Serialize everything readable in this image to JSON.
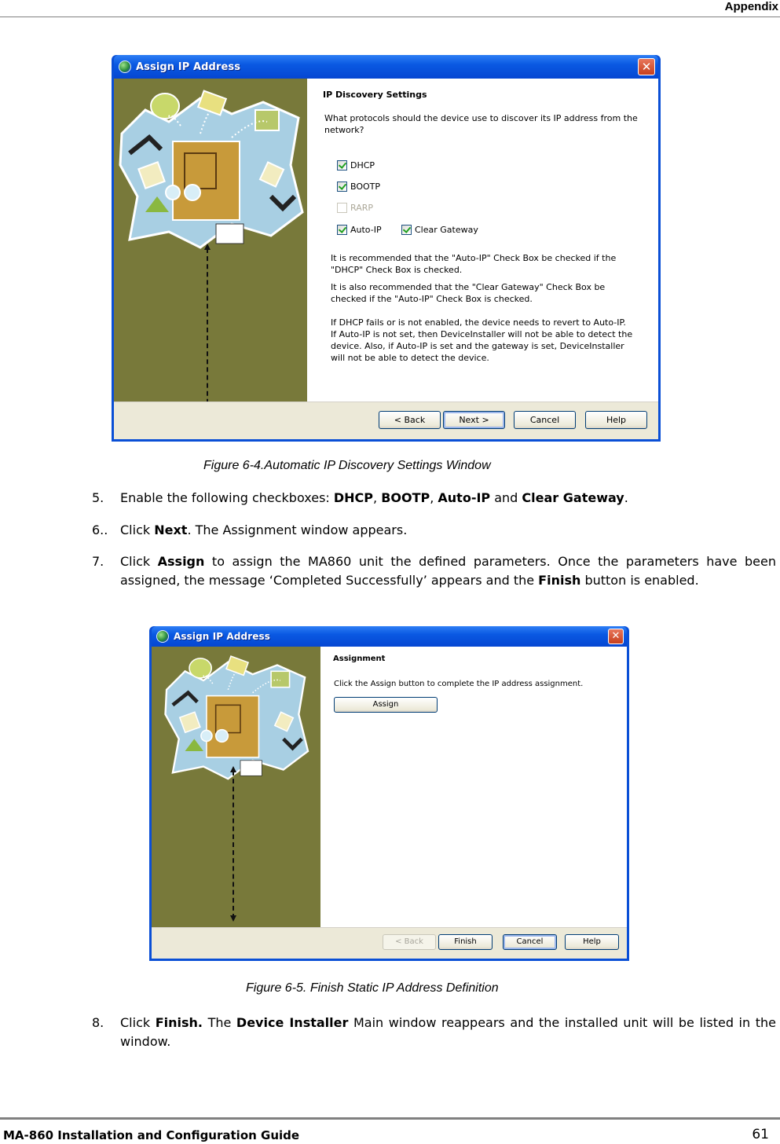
{
  "page": {
    "header_title": "Appendix",
    "footer_guide": "MA-860 Installation and Configuration Guide",
    "page_number": "61"
  },
  "figure1": {
    "window_title": "Assign IP Address",
    "close_glyph": "✕",
    "section_title": "IP Discovery Settings",
    "question": "What protocols should the device use to discover its IP address from the network?",
    "checkboxes": [
      {
        "label": "DHCP",
        "checked": true,
        "enabled": true
      },
      {
        "label": "BOOTP",
        "checked": true,
        "enabled": true
      },
      {
        "label": "RARP",
        "checked": false,
        "enabled": false
      },
      {
        "label": "Auto-IP",
        "checked": true,
        "enabled": true
      },
      {
        "label": "Clear Gateway",
        "checked": true,
        "enabled": true
      }
    ],
    "note1": "It is recommended that the \"Auto-IP\" Check Box be checked if the \"DHCP\" Check Box is checked.",
    "note2": "It is  also recommended that the \"Clear Gateway\" Check Box be checked if the \"Auto-IP\" Check Box is checked.",
    "note3": "If DHCP fails or is not enabled, the device needs to revert to Auto-IP.  If Auto-IP is not set, then DeviceInstaller will not be able to detect the device.  Also, if Auto-IP is set and the gateway is set, DeviceInstaller will not be able to detect the device.",
    "buttons": {
      "back": "< Back",
      "next": "Next >",
      "cancel": "Cancel",
      "help": "Help"
    },
    "caption": "Figure 6-4.Automatic  IP Discovery Settings Window"
  },
  "steps_a": [
    {
      "num": "5.",
      "parts": [
        {
          "t": "Enable the following checkboxes: ",
          "b": false
        },
        {
          "t": "DHCP",
          "b": true
        },
        {
          "t": ", ",
          "b": false
        },
        {
          "t": "BOOTP",
          "b": true
        },
        {
          "t": ", ",
          "b": false
        },
        {
          "t": "Auto-IP",
          "b": true
        },
        {
          "t": " and ",
          "b": false
        },
        {
          "t": "Clear Gateway",
          "b": true
        },
        {
          "t": ".",
          "b": false
        }
      ]
    },
    {
      "num": "6..",
      "parts": [
        {
          "t": "Click ",
          "b": false
        },
        {
          "t": "Next",
          "b": true
        },
        {
          "t": ". The Assignment window appears.",
          "b": false
        }
      ]
    },
    {
      "num": "7.",
      "parts": [
        {
          "t": "Click ",
          "b": false
        },
        {
          "t": "Assign",
          "b": true
        },
        {
          "t": " to assign the MA860 unit the defined parameters. Once the parameters have been assigned, the message ‘Completed Successfully’ appears and the ",
          "b": false
        },
        {
          "t": "Finish",
          "b": true
        },
        {
          "t": " button is enabled.",
          "b": false
        }
      ]
    }
  ],
  "figure2": {
    "window_title": "Assign IP Address",
    "close_glyph": "✕",
    "section_title": "Assignment",
    "instruction": "Click the Assign button to complete the IP address assignment.",
    "assign_button": "Assign",
    "buttons": {
      "back": "< Back",
      "finish": "Finish",
      "cancel": "Cancel",
      "help": "Help"
    },
    "caption": "Figure 6-5. Finish Static IP Address Definition"
  },
  "steps_b": [
    {
      "num": "8.",
      "parts": [
        {
          "t": "Click ",
          "b": false
        },
        {
          "t": "Finish.",
          "b": true
        },
        {
          "t": " The ",
          "b": false
        },
        {
          "t": "Device Installer",
          "b": true
        },
        {
          "t": " Main window reappears and the installed unit will be listed in the window.",
          "b": false
        }
      ]
    }
  ]
}
